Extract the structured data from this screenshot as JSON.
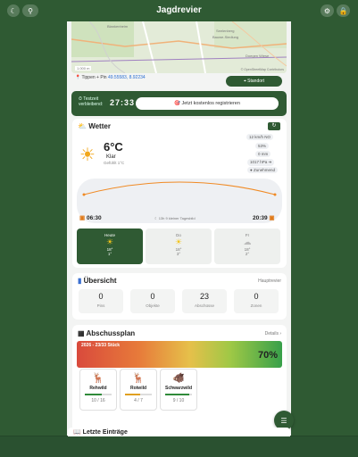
{
  "app": {
    "title": "Jagdrevier"
  },
  "map": {
    "labels": [
      "Blankenheim",
      "Seelenberg",
      "Bauwe-Siedlung",
      "Jetzt-bleibt",
      "Doegen Wiese"
    ],
    "scale": "1.000 m",
    "attribution": "© OpenStreetMap Contributors"
  },
  "location": {
    "coords_prefix": "Tippen + Pin",
    "coords": "49.55583, 8.92234",
    "standort_label": "Standort"
  },
  "trial": {
    "label_line1": "Testzeit",
    "label_line2": "verbleibend:",
    "time": "27:33",
    "register_label": "Jetzt kostenlos registrieren"
  },
  "weather": {
    "title": "Wetter",
    "temp": "6°C",
    "condition": "Klar",
    "feels_like": "Gefühlt 1°C",
    "wind": "12 km/h NO",
    "humidity": "53%",
    "rain": "0 mm",
    "pressure": "1017 hPa ➔",
    "moon": "Zunehmend",
    "sunrise": "06:30",
    "sunset": "20:39",
    "daylight_label": "13h 9 kleiner Tagesbild",
    "days": [
      {
        "name": "Heute",
        "high": "18°",
        "low": "1°"
      },
      {
        "name": "Do",
        "high": "18°",
        "low": "3°"
      },
      {
        "name": "Fr",
        "high": "18°",
        "low": "2°"
      }
    ]
  },
  "overview": {
    "title": "Übersicht",
    "link": "Hauptrevier",
    "stats": [
      {
        "value": "0",
        "label": "Pins"
      },
      {
        "value": "0",
        "label": "Objekte"
      },
      {
        "value": "23",
        "label": "Abschüsse"
      },
      {
        "value": "0",
        "label": "Zonen"
      }
    ]
  },
  "plan": {
    "title": "Abschussplan",
    "link": "Details ›",
    "range": "2026 - 23/33 Stück",
    "percent": "70%",
    "percent_value": 70,
    "species": [
      {
        "name": "Rehwild",
        "count": "10 / 16",
        "bar_color": "#2f8a3a",
        "fill": 0.62
      },
      {
        "name": "Rotwild",
        "count": "4 / 7",
        "bar_color": "#e0a020",
        "fill": 0.57
      },
      {
        "name": "Schwarzwild",
        "count": "9 / 10",
        "bar_color": "#2f8a3a",
        "fill": 0.9
      }
    ]
  },
  "recent": {
    "title": "Letzte Einträge"
  },
  "colors": {
    "brand": "#2f5a33",
    "accent": "#e07a1a"
  }
}
